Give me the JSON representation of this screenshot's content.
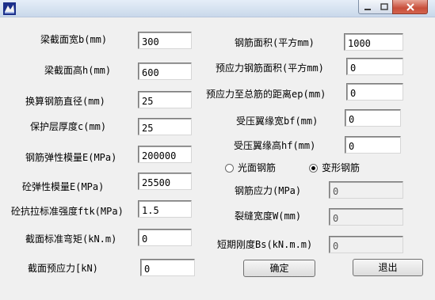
{
  "window": {
    "controls": {
      "minimize": "–",
      "maximize": "□",
      "close": "✕"
    }
  },
  "left": [
    {
      "label": "梁截面宽b(mm)",
      "value": "300"
    },
    {
      "label": "梁截面高h(mm)",
      "value": "600"
    },
    {
      "label": "换算钢筋直径(mm)",
      "value": "25"
    },
    {
      "label": "保护层厚度c(mm)",
      "value": "25"
    },
    {
      "label": "钢筋弹性模量E(MPa)",
      "value": "200000"
    },
    {
      "label": "砼弹性模量E(MPa)",
      "value": "25500"
    },
    {
      "label": "砼抗拉标准强度ftk(MPa)",
      "value": "1.5"
    },
    {
      "label": "截面标准弯矩(kN.m)",
      "value": "0"
    },
    {
      "label": "截面预应力[kN)",
      "value": "0"
    }
  ],
  "right": [
    {
      "label": "钢筋面积(平方mm)",
      "value": "1000"
    },
    {
      "label": "预应力钢筋面积(平方mm)",
      "value": "0"
    },
    {
      "label": "预应力至总筋的距离ep(mm)",
      "value": "0"
    },
    {
      "label": "受压翼缘宽bf(mm)",
      "value": "0"
    },
    {
      "label": "受压翼缘高hf(mm)",
      "value": "0"
    }
  ],
  "rebar_type": {
    "options": [
      "光面钢筋",
      "变形钢筋"
    ],
    "selected": "变形钢筋"
  },
  "results": [
    {
      "label": "钢筋应力(MPa)",
      "value": "0"
    },
    {
      "label": "裂缝宽度W(mm)",
      "value": "0"
    },
    {
      "label": "短期刚度Bs(kN.m.m)",
      "value": "0"
    }
  ],
  "buttons": {
    "ok": "确定",
    "exit": "退出"
  },
  "colors": {
    "close_button": "#c84f3b",
    "titlebar": "#c9d8ea",
    "form_bg": "#f0f0f0"
  }
}
